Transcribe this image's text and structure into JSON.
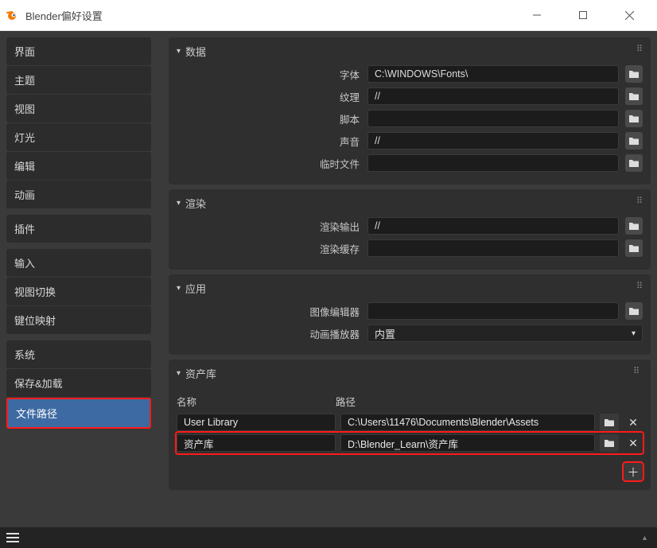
{
  "window": {
    "title": "Blender偏好设置"
  },
  "sidebar": {
    "groups": [
      {
        "items": [
          "界面",
          "主题",
          "视图",
          "灯光",
          "编辑",
          "动画"
        ]
      },
      {
        "items": [
          "插件"
        ]
      },
      {
        "items": [
          "输入",
          "视图切换",
          "键位映射"
        ]
      },
      {
        "items": [
          "系统",
          "保存&加载",
          "文件路径"
        ]
      }
    ],
    "active": "文件路径"
  },
  "panels": {
    "data": {
      "title": "数据",
      "rows": [
        {
          "label": "字体",
          "value": "C:\\WINDOWS\\Fonts\\"
        },
        {
          "label": "纹理",
          "value": "//"
        },
        {
          "label": "脚本",
          "value": ""
        },
        {
          "label": "声音",
          "value": "//"
        },
        {
          "label": "临时文件",
          "value": ""
        }
      ]
    },
    "render": {
      "title": "渲染",
      "rows": [
        {
          "label": "渲染输出",
          "value": "//"
        },
        {
          "label": "渲染缓存",
          "value": ""
        }
      ]
    },
    "apps": {
      "title": "应用",
      "image_editor_label": "图像编辑器",
      "image_editor_value": "",
      "anim_player_label": "动画播放器",
      "anim_player_value": "内置"
    },
    "assets": {
      "title": "资产库",
      "colName": "名称",
      "colPath": "路径",
      "rows": [
        {
          "name": "User Library",
          "path": "C:\\Users\\11476\\Documents\\Blender\\Assets"
        },
        {
          "name": "资产库",
          "path": "D:\\Blender_Learn\\资产库"
        }
      ]
    }
  }
}
